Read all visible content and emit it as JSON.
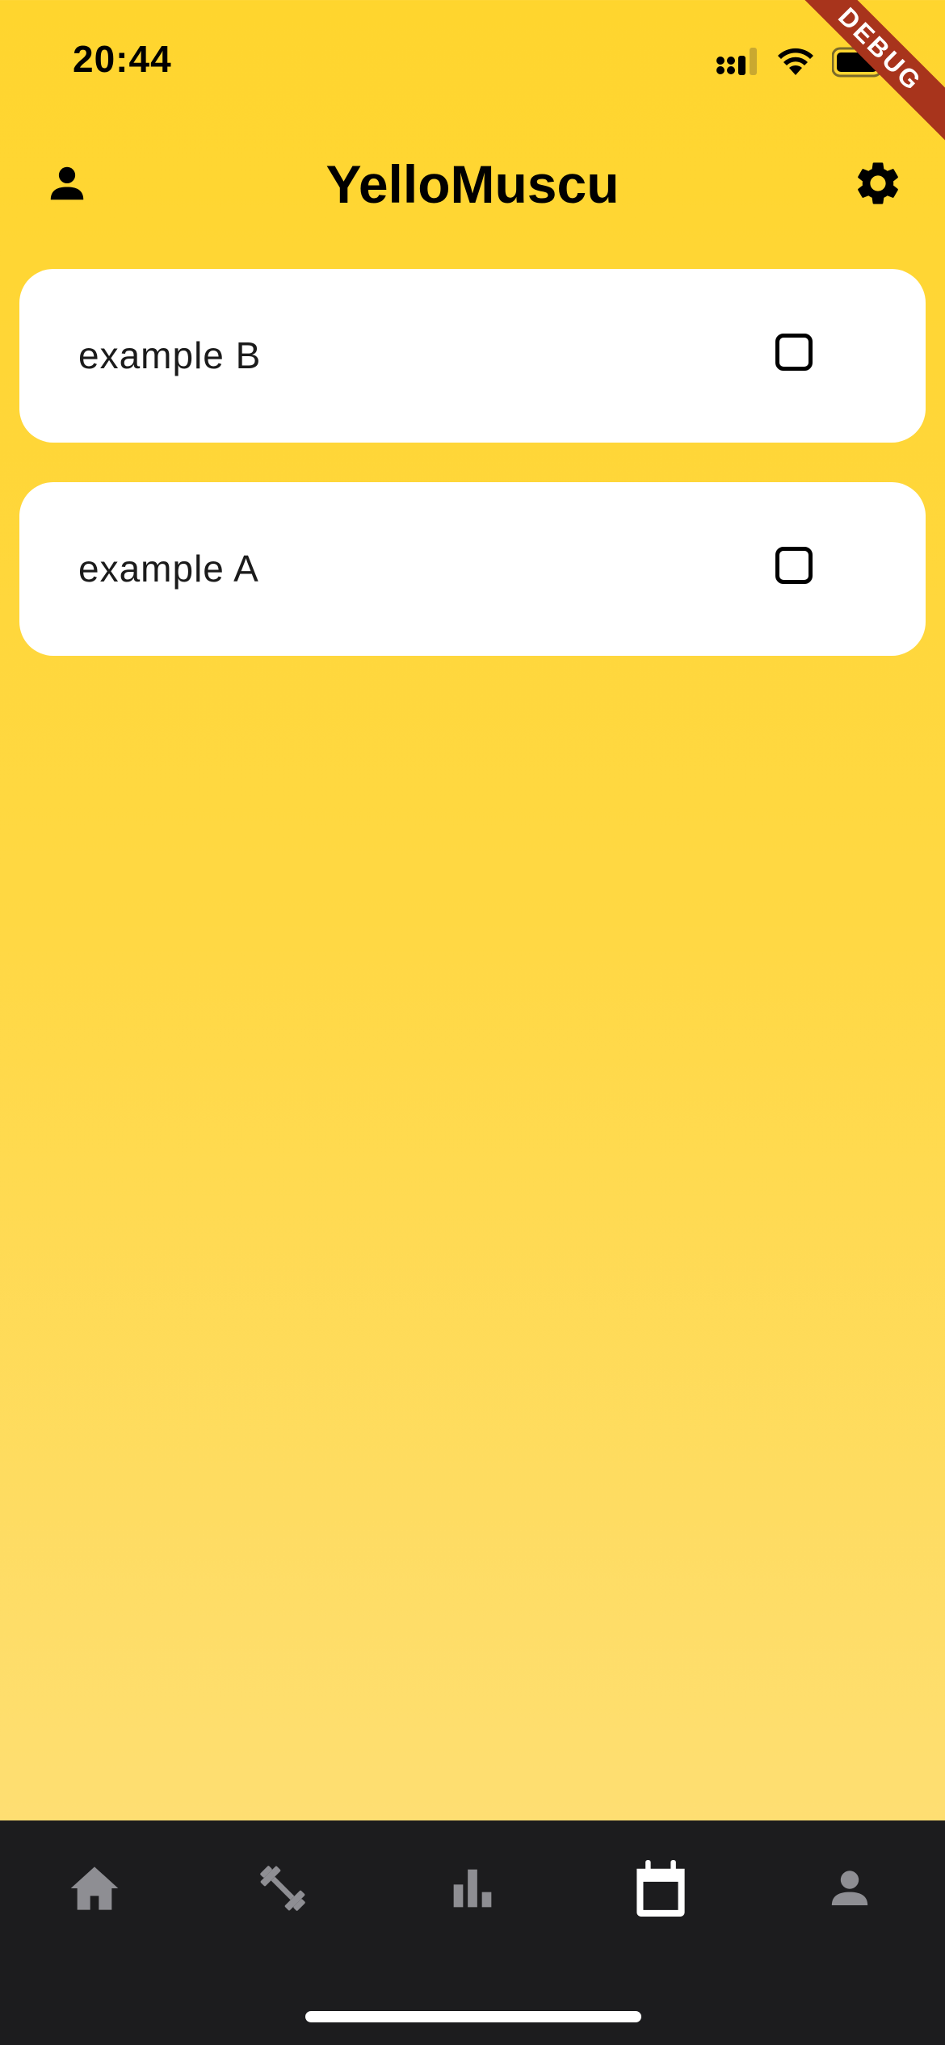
{
  "status_bar": {
    "time": "20:44",
    "debug_label": "DEBUG"
  },
  "app_bar": {
    "title": "YelloMuscu",
    "left_icon": "person-icon",
    "right_icon": "gear-icon"
  },
  "tasks": [
    {
      "label": "example B",
      "checked": false
    },
    {
      "label": "example A",
      "checked": false
    }
  ],
  "bottom_nav": {
    "items": [
      {
        "icon": "home-icon",
        "active": false
      },
      {
        "icon": "dumbbell-icon",
        "active": false
      },
      {
        "icon": "bar-chart-icon",
        "active": false
      },
      {
        "icon": "calendar-icon",
        "active": true
      },
      {
        "icon": "person-icon",
        "active": false
      }
    ]
  },
  "colors": {
    "background_top": "#FFD52E",
    "background_bottom": "#FEE07E",
    "card": "#FFFFFF",
    "nav_background": "#1C1C1E",
    "nav_inactive": "#8E8E93",
    "nav_active": "#FFFFFF",
    "debug_ribbon": "#A8341C"
  }
}
